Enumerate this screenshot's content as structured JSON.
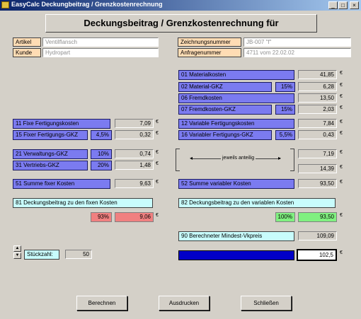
{
  "window": {
    "title": "EasyCalc Deckungbeitrag / Grenzkostenrechnung",
    "controls": [
      "_",
      "□",
      "×"
    ]
  },
  "heading": "Deckungsbeitrag / Grenzkostenrechnung für",
  "header_fields": {
    "artikel_label": "Artikel",
    "artikel_value": "Ventilflansch",
    "kunde_label": "Kunde",
    "kunde_value": "Hydropart",
    "zeichnung_label": "Zeichnungsnummer",
    "zeichnung_value": "JB-007    \"f\"",
    "anfrage_label": "Anfragenummer",
    "anfrage_value": "4711 vom 22.02.02"
  },
  "currency": "€",
  "right_costs": [
    {
      "label": "01 Materialkosten",
      "pct": "",
      "value": "41,85"
    },
    {
      "label": "02 Material-GKZ",
      "pct": "15%",
      "value": "6,28"
    },
    {
      "label": "06 Fremdkosten",
      "pct": "",
      "value": "13,50"
    },
    {
      "label": "07 Fremdkosten-GKZ",
      "pct": "15%",
      "value": "2,03"
    },
    {
      "label": "12 Variable Fertigungskosten",
      "pct": "",
      "value": "7,84"
    },
    {
      "label": "16 Variabler Fertigungs-GKZ",
      "pct": "5,5%",
      "value": "0,43"
    }
  ],
  "left_costs": [
    {
      "label": "11 Fixe Fertigungskosten",
      "pct": "",
      "value": "7,09"
    },
    {
      "label": "15 Fixer Fertigungs-GKZ",
      "pct": "4,5%",
      "value": "0,32"
    },
    {
      "label": "21 Verwaltungs-GKZ",
      "pct": "10%",
      "value": "0,74"
    },
    {
      "label": "31 Vertriebs-GKZ",
      "pct": "20%",
      "value": "1,48"
    }
  ],
  "jeweils": {
    "text": "jeweils anteilig",
    "value1": "7,19",
    "value2": "14,39"
  },
  "sum_fixed": {
    "label": "51 Summe fixer Kosten",
    "value": "9,63"
  },
  "sum_variable": {
    "label": "52 Summe variabler Kosten",
    "value": "93,50"
  },
  "db_fixed": {
    "label": "81 Deckungsbeitrag zu den fixen Kosten",
    "pct": "93%",
    "value": "9,06"
  },
  "db_variable": {
    "label": "82 Deckungsbeitrag zu den variablen Kosten",
    "pct": "100%",
    "value": "93,50"
  },
  "mindest": {
    "label": "90 Berechneter Mindest-Vkpreis",
    "value": "109,09"
  },
  "selected_price": {
    "label": "",
    "value": "102,5"
  },
  "stueckzahl": {
    "label": "Stückzahl:",
    "value": "50"
  },
  "buttons": {
    "berechnen": "Berechnen",
    "ausdrucken": "Ausdrucken",
    "schliessen": "Schließen"
  },
  "colors": {
    "blue_label": "#7b7bf0",
    "tan_label": "#ffdcb4",
    "cyan_label": "#c8fcfc",
    "red_value": "#f08080",
    "green_value": "#80f080",
    "selected": "#0000c8"
  }
}
